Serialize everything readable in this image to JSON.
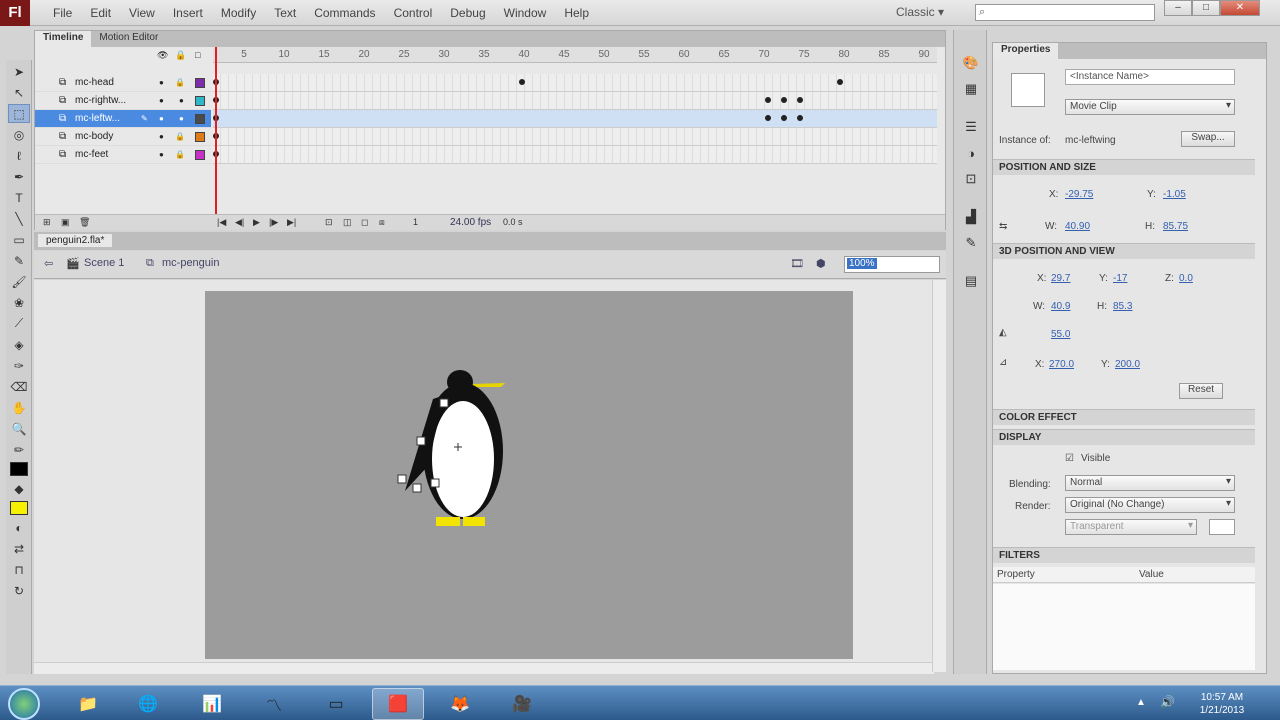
{
  "app": {
    "logo_text": "Fl",
    "menu": [
      "File",
      "Edit",
      "View",
      "Insert",
      "Modify",
      "Text",
      "Commands",
      "Control",
      "Debug",
      "Window",
      "Help"
    ],
    "workspace": "Classic ▾",
    "window_controls": [
      "–",
      "□",
      "✕"
    ]
  },
  "timeline": {
    "tabs": [
      "Timeline",
      "Motion Editor"
    ],
    "frame_numbers": [
      5,
      10,
      15,
      20,
      25,
      30,
      35,
      40,
      45,
      50,
      55,
      60,
      65,
      70,
      75,
      80,
      85,
      90
    ],
    "layers": [
      {
        "name": "mc-head",
        "color": "#7b2ea8"
      },
      {
        "name": "mc-rightw...",
        "color": "#2fb7c9"
      },
      {
        "name": "mc-leftw...",
        "color": "#4a4a4a",
        "selected": true
      },
      {
        "name": "mc-body",
        "color": "#e07c18"
      },
      {
        "name": "mc-feet",
        "color": "#c530c5"
      }
    ],
    "fps": "24.00 fps",
    "elapsed": "0.0 s",
    "frame": "1"
  },
  "document": {
    "tab_label": "penguin2.fla*",
    "crumb_scene": "Scene 1",
    "crumb_symbol": "mc-penguin",
    "zoom": "100%"
  },
  "properties": {
    "tab": "Properties",
    "instance_name_placeholder": "<Instance Name>",
    "symbol_type": "Movie Clip",
    "instance_of_label": "Instance of:",
    "instance_of_value": "mc-leftwing",
    "swap_label": "Swap...",
    "sections": {
      "position": "POSITION AND SIZE",
      "three_d": "3D POSITION AND VIEW",
      "color": "COLOR EFFECT",
      "display": "DISPLAY",
      "filters": "FILTERS"
    },
    "x": "-29.75",
    "y": "-1.05",
    "w": "40.90",
    "h": "85.75",
    "x3d": "29.7",
    "y3d": "-17",
    "z3d": "0.0",
    "w3d": "40.9",
    "h3d": "85.3",
    "fov": "55.0",
    "vx": "270.0",
    "vy": "200.0",
    "reset_label": "Reset",
    "visible_label": "Visible",
    "blending_label": "Blending:",
    "blending_value": "Normal",
    "render_label": "Render:",
    "render_value": "Original (No Change)",
    "transparent_value": "Transparent",
    "filter_col_property": "Property",
    "filter_col_value": "Value"
  },
  "taskbar": {
    "time": "10:57 AM",
    "date": "1/21/2013"
  }
}
